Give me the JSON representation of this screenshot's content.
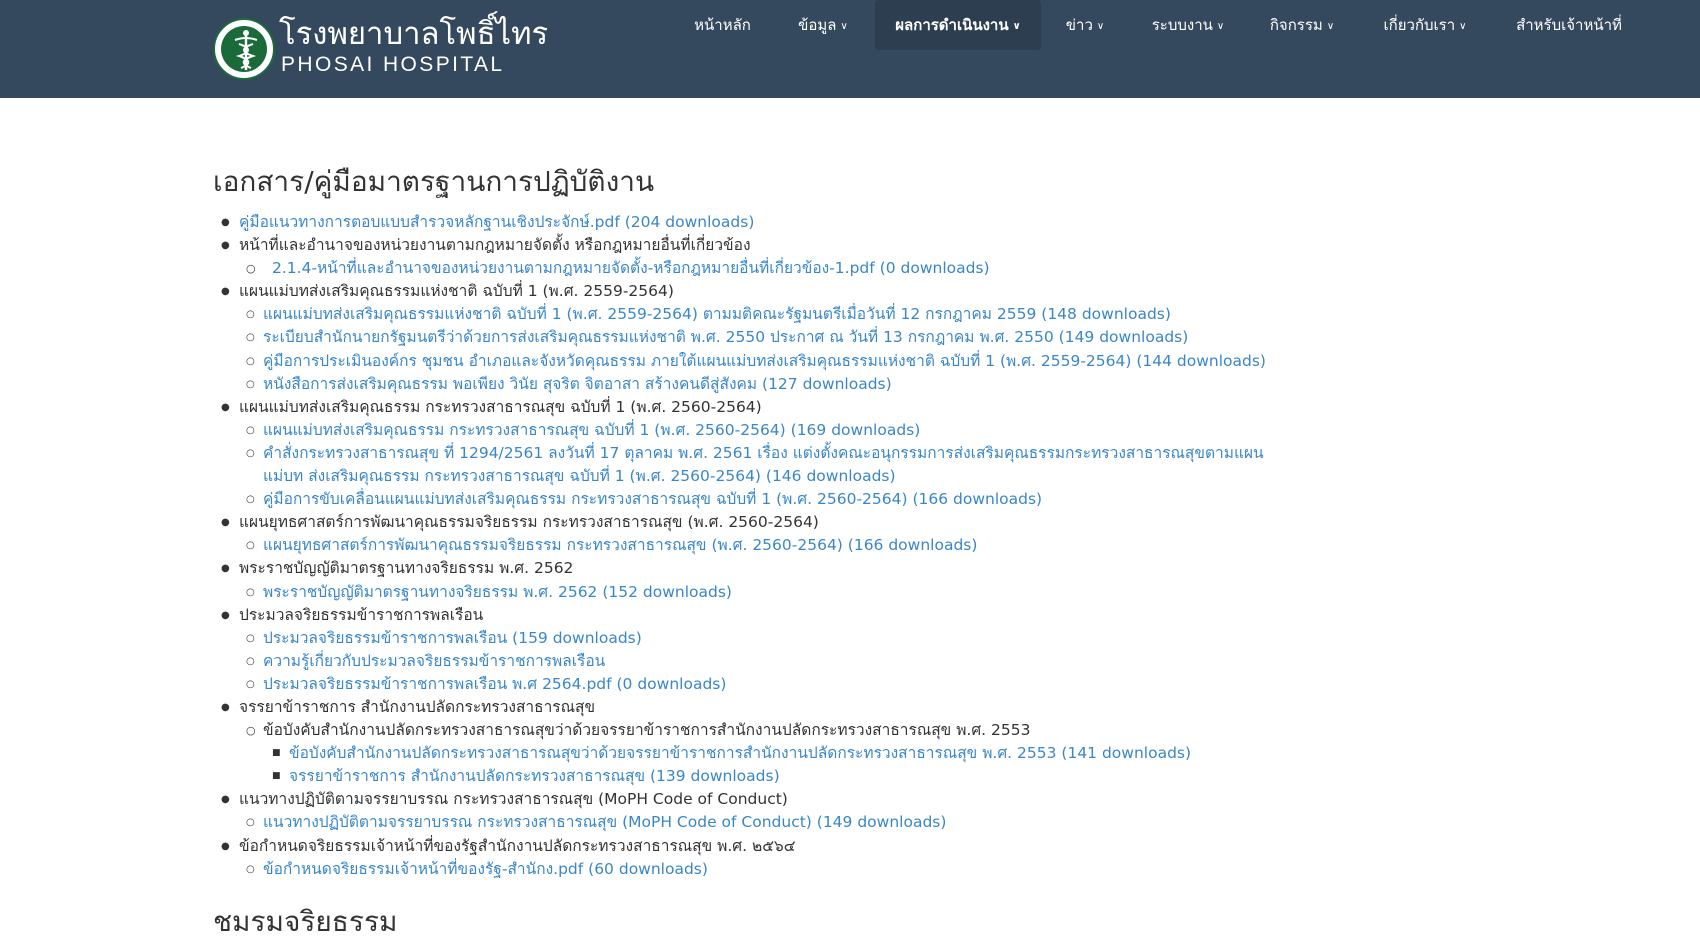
{
  "colors": {
    "navbar": "#34495e",
    "active_menu": "#2c3e50",
    "link": "#3a87c8",
    "text": "#333333"
  },
  "logo": {
    "thai_name": "โรงพยาบาลโพธิ์ไทร",
    "english_name": "PHOSAI HOSPITAL",
    "seal_icon": "ministry-public-health-seal-icon"
  },
  "menu": [
    {
      "label": "หน้าหลัก",
      "dropdown": false,
      "active": false
    },
    {
      "label": "ข้อมูล",
      "dropdown": true,
      "active": false
    },
    {
      "label": "ผลการดำเนินงาน",
      "dropdown": true,
      "active": true
    },
    {
      "label": "ข่าว",
      "dropdown": true,
      "active": false
    },
    {
      "label": "ระบบงาน",
      "dropdown": true,
      "active": false
    },
    {
      "label": "กิจกรรม",
      "dropdown": true,
      "active": false
    },
    {
      "label": "เกี่ยวกับเรา",
      "dropdown": true,
      "active": false
    },
    {
      "label": "สำหรับเจ้าหน้าที่",
      "dropdown": false,
      "active": false
    }
  ],
  "page": {
    "title": "เอกสาร/คู่มือมาตรฐานการปฏิบัติงาน",
    "next_section_title": "ชมรมจริยธรรม"
  },
  "documents": [
    {
      "level": 1,
      "text": "คู่มือแนวทางการตอบแบบสำรวจหลักฐานเชิงประจักษ์.pdf (204 downloads)",
      "link": true
    },
    {
      "level": 1,
      "text": "หน้าที่และอำนาจของหน่วยงานตามกฎหมายจัดตั้ง หรือกฎหมายอื่นที่เกี่ยวข้อง",
      "link": false
    },
    {
      "level": 2,
      "text": "2.1.4-หน้าที่และอำนาจของหน่วยงานตามกฎหมายจัดตั้ง-หรือกฎหมายอื่นที่เกี่ยวข้อง-1.pdf (0 downloads)",
      "link": true,
      "hollow": true
    },
    {
      "level": 1,
      "text": "แผนแม่บทส่งเสริมคุณธรรมแห่งชาติ ฉบับที่ 1 (พ.ศ. 2559-2564)",
      "link": false
    },
    {
      "level": 2,
      "text": "แผนแม่บทส่งเสริมคุณธรรมแห่งชาติ ฉบับที่ 1 (พ.ศ. 2559-2564) ตามมติคณะรัฐมนตรีเมื่อวันที่ 12 กรกฎาคม 2559 (148 downloads)",
      "link": true
    },
    {
      "level": 2,
      "text": "ระเบียบสำนักนายกรัฐมนตรีว่าด้วยการส่งเสริมคุณธรรมแห่งชาติ พ.ศ. 2550 ประกาศ ณ วันที่ 13 กรกฎาคม พ.ศ. 2550 (149 downloads)",
      "link": true
    },
    {
      "level": 2,
      "text": "คู่มือการประเมินองค์กร ชุมชน อำเภอและจังหวัดคุณธรรม ภายใต้แผนแม่บทส่งเสริมคุณธรรมแห่งชาติ ฉบับที่ 1 (พ.ศ. 2559-2564) (144 downloads)",
      "link": true
    },
    {
      "level": 2,
      "text": "หนังสือการส่งเสริมคุณธรรม พอเพียง วินัย สุจริต จิตอาสา สร้างคนดีสู่สังคม (127 downloads)",
      "link": true
    },
    {
      "level": 1,
      "text": "แผนแม่บทส่งเสริมคุณธรรม กระทรวงสาธารณสุข ฉบับที่ 1 (พ.ศ. 2560-2564)",
      "link": false
    },
    {
      "level": 2,
      "text": "แผนแม่บทส่งเสริมคุณธรรม กระทรวงสาธารณสุข ฉบับที่ 1 (พ.ศ. 2560-2564) (169 downloads)",
      "link": true
    },
    {
      "level": 2,
      "text": "คำสั่งกระทรวงสาธารณสุข ที่ 1294/2561 ลงวันที่ 17 ตุลาคม พ.ศ. 2561 เรื่อง แต่งตั้งคณะอนุกรรมการส่งเสริมคุณธรรมกระทรวงสาธารณสุขตามแผนแม่บท ส่งเสริมคุณธรรม กระทรวงสาธารณสุข ฉบับที่ 1 (พ.ศ. 2560-2564) (146 downloads)",
      "link": true,
      "wrap": true
    },
    {
      "level": 2,
      "text": "คู่มือการขับเคลื่อนแผนแม่บทส่งเสริมคุณธรรม กระทรวงสาธารณสุข ฉบับที่ 1 (พ.ศ. 2560-2564) (166 downloads)",
      "link": true
    },
    {
      "level": 1,
      "text": "แผนยุทธศาสตร์การพัฒนาคุณธรรมจริยธรรม กระทรวงสาธารณสุข (พ.ศ. 2560-2564)",
      "link": false
    },
    {
      "level": 2,
      "text": "แผนยุทธศาสตร์การพัฒนาคุณธรรมจริยธรรม กระทรวงสาธารณสุข (พ.ศ. 2560-2564) (166 downloads)",
      "link": true
    },
    {
      "level": 1,
      "text": "พระราชบัญญัติมาตรฐานทางจริยธรรม พ.ศ. 2562",
      "link": false
    },
    {
      "level": 2,
      "text": "พระราชบัญญัติมาตรฐานทางจริยธรรม พ.ศ. 2562 (152 downloads)",
      "link": true
    },
    {
      "level": 1,
      "text": "ประมวลจริยธรรมข้าราชการพลเรือน",
      "link": false
    },
    {
      "level": 2,
      "text": "ประมวลจริยธรรมข้าราชการพลเรือน (159 downloads)",
      "link": true
    },
    {
      "level": 2,
      "text": "ความรู้เกี่ยวกับประมวลจริยธรรมข้าราชการพลเรือน",
      "link": true
    },
    {
      "level": 2,
      "text": "ประมวลจริยธรรมข้าราชการพลเรือน พ.ศ 2564.pdf (0 downloads)",
      "link": true
    },
    {
      "level": 1,
      "text": "จรรยาข้าราชการ สำนักงานปลัดกระทรวงสาธารณสุข",
      "link": false
    },
    {
      "level": 2,
      "text": "ข้อบังคับสำนักงานปลัดกระทรวงสาธารณสุขว่าด้วยจรรยาข้าราชการสำนักงานปลัดกระทรวงสาธารณสุข พ.ศ. 2553",
      "link": false,
      "hollow": true
    },
    {
      "level": 3,
      "text": "ข้อบังคับสำนักงานปลัดกระทรวงสาธารณสุขว่าด้วยจรรยาข้าราชการสำนักงานปลัดกระทรวงสาธารณสุข พ.ศ. 2553 (141 downloads)",
      "link": true
    },
    {
      "level": 3,
      "text": "จรรยาข้าราชการ สำนักงานปลัดกระทรวงสาธารณสุข (139 downloads)",
      "link": true
    },
    {
      "level": 1,
      "text": "แนวทางปฏิบัติตามจรรยาบรรณ กระทรวงสาธารณสุข (MoPH Code of Conduct)",
      "link": false
    },
    {
      "level": 2,
      "text": "แนวทางปฏิบัติตามจรรยาบรรณ กระทรวงสาธารณสุข (MoPH Code of Conduct) (149 downloads)",
      "link": true
    },
    {
      "level": 1,
      "text": "ข้อกำหนดจริยธรรมเจ้าหน้าที่ของรัฐสำนักงานปลัดกระทรวงสาธารณสุข พ.ศ. ๒๕๖๔",
      "link": false
    },
    {
      "level": 2,
      "text": "ข้อกำหนดจริยธรรมเจ้าหน้าที่ของรัฐ-สำนักง.pdf (60 downloads)",
      "link": true
    }
  ]
}
